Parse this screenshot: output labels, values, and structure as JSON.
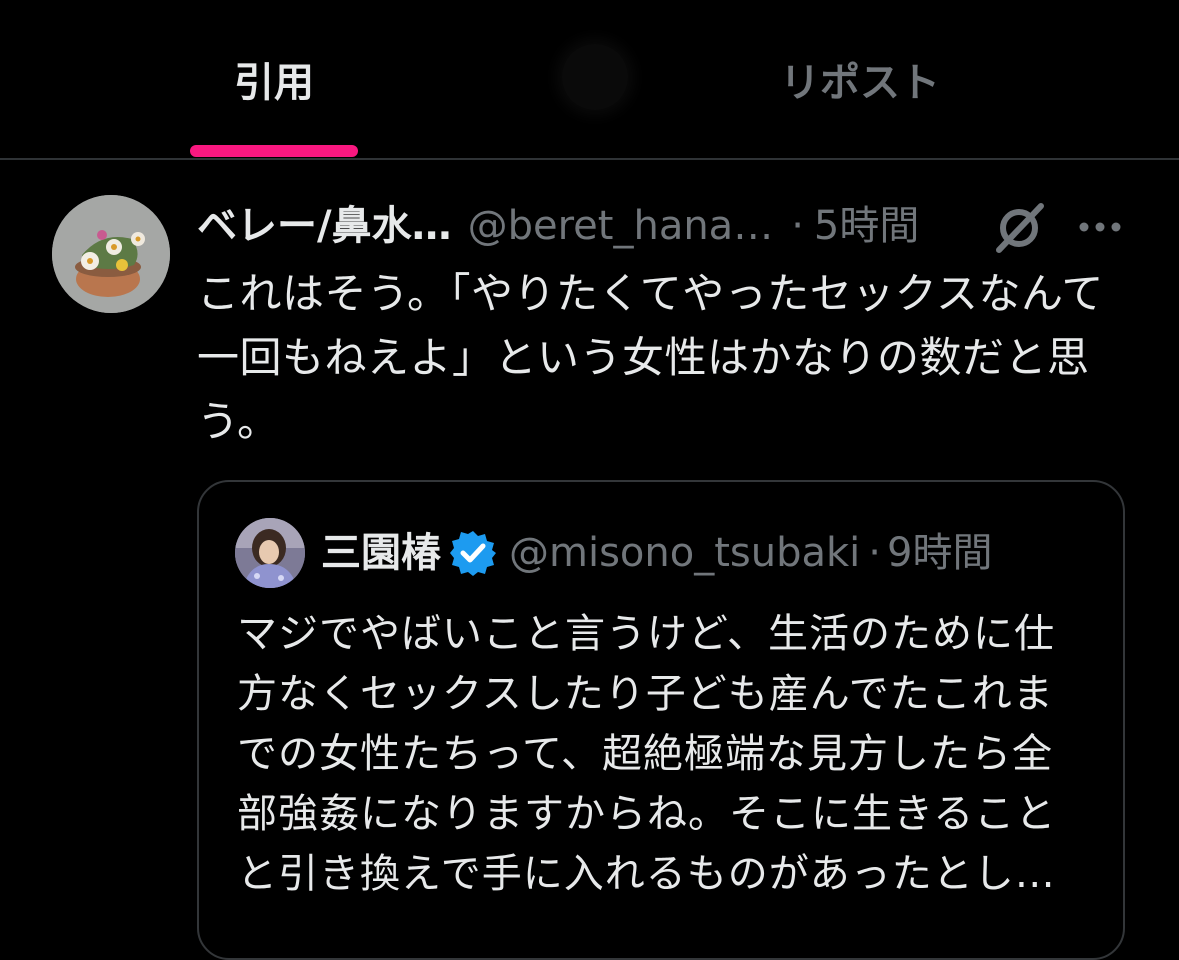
{
  "tabs": [
    {
      "label": "引用",
      "selected": true
    },
    {
      "label": "リポスト",
      "selected": false
    }
  ],
  "colors": {
    "accent": "#f91880",
    "background": "#000000",
    "text_primary": "#e7e9ea",
    "text_secondary": "#71767b",
    "border": "#2f3336",
    "verified_blue": "#1d9bf0"
  },
  "post": {
    "display_name": "ベレー/鼻水…",
    "handle": "@beret_hana…",
    "separator": "·",
    "time": "5時間",
    "icons": [
      "grok-icon",
      "more-icon"
    ],
    "text_lines": [
      "これはそう。「やりたくてやったセックスなんて",
      "一回もねえよ」という女性はかなりの数だと思",
      "う。"
    ],
    "quoted": {
      "display_name": "三園椿",
      "verified": true,
      "handle": "@misono_tsubaki",
      "separator": "·",
      "time": "9時間",
      "text_lines": [
        "マジでやばいこと言うけど、生活のために仕",
        "方なくセックスしたり子ども産んでたこれま",
        "での女性たちって、超絶極端な見方したら全",
        "部強姦になりますからね。そこに生きること",
        "と引き換えで手に入れるものがあったとし…"
      ]
    }
  }
}
